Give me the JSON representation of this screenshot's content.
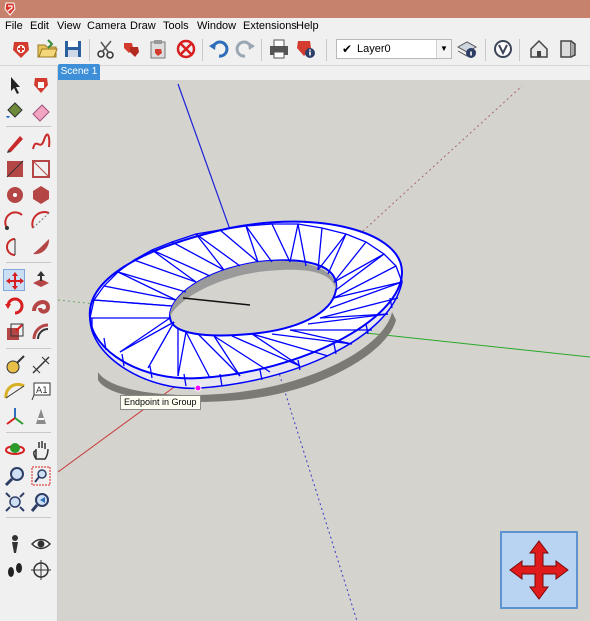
{
  "menu": [
    "File",
    "Edit",
    "View",
    "Camera",
    "Draw",
    "Tools",
    "Window",
    "Extensions",
    "Help"
  ],
  "layer": {
    "name": "Layer0"
  },
  "scene_tab": "Scene 1",
  "tooltip": "Endpoint in Group",
  "colors": {
    "titlebar": "#c6826c",
    "viewport": "#d4d3ce",
    "selection": "#0000ff",
    "scene_tab": "#3d8fd8"
  },
  "toolbar_icons": [
    "new-model-icon",
    "open-icon",
    "save-icon",
    "cut-icon",
    "copy-icon",
    "paste-icon",
    "erase-icon",
    "undo-icon",
    "redo-icon",
    "print-icon",
    "model-info-icon",
    "layer-check-icon",
    "layer-manager-icon",
    "display-options-icon",
    "house-view-icon",
    "front-view-icon"
  ],
  "left_icons": [
    "select-icon",
    "make-component-icon",
    "paint-bucket-icon",
    "eraser-icon",
    "pencil-icon",
    "freehand-icon",
    "rectangle-icon",
    "rotated-rectangle-icon",
    "circle-icon",
    "polygon-icon",
    "arc-icon",
    "arc-2pt-icon",
    "pie-icon",
    "arc-3pt-icon",
    "move-icon",
    "push-pull-icon",
    "rotate-icon",
    "follow-me-icon",
    "scale-icon",
    "offset-icon",
    "tape-measure-icon",
    "dimension-icon",
    "protractor-icon",
    "text-icon",
    "axes-icon",
    "3d-text-icon",
    "orbit-icon",
    "pan-icon",
    "zoom-icon",
    "zoom-window-icon",
    "zoom-extents-icon",
    "previous-view-icon",
    "position-camera-icon",
    "look-around-icon",
    "walk-icon",
    "section-plane-icon"
  ]
}
